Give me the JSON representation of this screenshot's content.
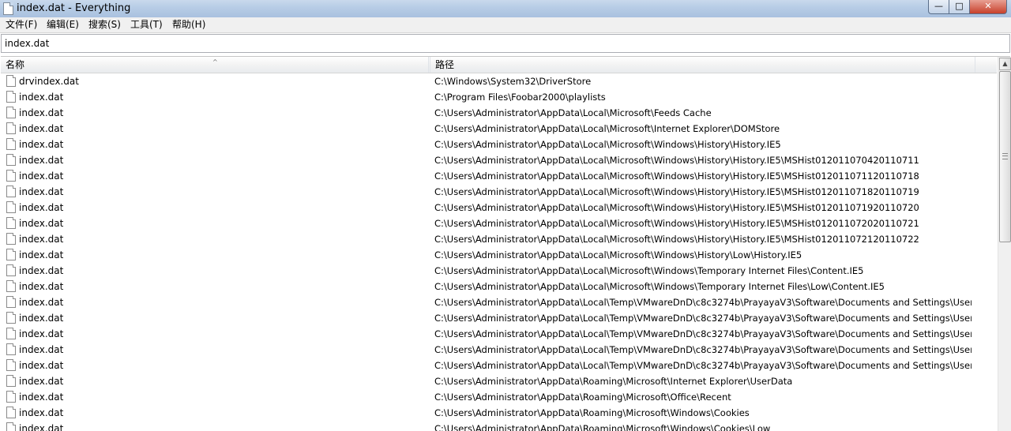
{
  "window": {
    "title": "index.dat - Everything",
    "controls": {
      "minimize": "—",
      "maximize": "□",
      "close": "✕"
    }
  },
  "menu": [
    {
      "label": "文件(F)"
    },
    {
      "label": "编辑(E)"
    },
    {
      "label": "搜索(S)"
    },
    {
      "label": "工具(T)"
    },
    {
      "label": "帮助(H)"
    }
  ],
  "search": {
    "value": "index.dat"
  },
  "columns": {
    "name": "名称",
    "path": "路径",
    "sort_indicator": "^"
  },
  "rows": [
    {
      "name": "drvindex.dat",
      "path": "C:\\Windows\\System32\\DriverStore"
    },
    {
      "name": "index.dat",
      "path": "C:\\Program Files\\Foobar2000\\playlists"
    },
    {
      "name": "index.dat",
      "path": "C:\\Users\\Administrator\\AppData\\Local\\Microsoft\\Feeds Cache"
    },
    {
      "name": "index.dat",
      "path": "C:\\Users\\Administrator\\AppData\\Local\\Microsoft\\Internet Explorer\\DOMStore"
    },
    {
      "name": "index.dat",
      "path": "C:\\Users\\Administrator\\AppData\\Local\\Microsoft\\Windows\\History\\History.IE5"
    },
    {
      "name": "index.dat",
      "path": "C:\\Users\\Administrator\\AppData\\Local\\Microsoft\\Windows\\History\\History.IE5\\MSHist012011070420110711"
    },
    {
      "name": "index.dat",
      "path": "C:\\Users\\Administrator\\AppData\\Local\\Microsoft\\Windows\\History\\History.IE5\\MSHist012011071120110718"
    },
    {
      "name": "index.dat",
      "path": "C:\\Users\\Administrator\\AppData\\Local\\Microsoft\\Windows\\History\\History.IE5\\MSHist012011071820110719"
    },
    {
      "name": "index.dat",
      "path": "C:\\Users\\Administrator\\AppData\\Local\\Microsoft\\Windows\\History\\History.IE5\\MSHist012011071920110720"
    },
    {
      "name": "index.dat",
      "path": "C:\\Users\\Administrator\\AppData\\Local\\Microsoft\\Windows\\History\\History.IE5\\MSHist012011072020110721"
    },
    {
      "name": "index.dat",
      "path": "C:\\Users\\Administrator\\AppData\\Local\\Microsoft\\Windows\\History\\History.IE5\\MSHist012011072120110722"
    },
    {
      "name": "index.dat",
      "path": "C:\\Users\\Administrator\\AppData\\Local\\Microsoft\\Windows\\History\\Low\\History.IE5"
    },
    {
      "name": "index.dat",
      "path": "C:\\Users\\Administrator\\AppData\\Local\\Microsoft\\Windows\\Temporary Internet Files\\Content.IE5"
    },
    {
      "name": "index.dat",
      "path": "C:\\Users\\Administrator\\AppData\\Local\\Microsoft\\Windows\\Temporary Internet Files\\Low\\Content.IE5"
    },
    {
      "name": "index.dat",
      "path": "C:\\Users\\Administrator\\AppData\\Local\\Temp\\VMwareDnD\\c8c3274b\\PrayayaV3\\Software\\Documents and Settings\\User\\Cook..."
    },
    {
      "name": "index.dat",
      "path": "C:\\Users\\Administrator\\AppData\\Local\\Temp\\VMwareDnD\\c8c3274b\\PrayayaV3\\Software\\Documents and Settings\\User\\Local..."
    },
    {
      "name": "index.dat",
      "path": "C:\\Users\\Administrator\\AppData\\Local\\Temp\\VMwareDnD\\c8c3274b\\PrayayaV3\\Software\\Documents and Settings\\User\\Local..."
    },
    {
      "name": "index.dat",
      "path": "C:\\Users\\Administrator\\AppData\\Local\\Temp\\VMwareDnD\\c8c3274b\\PrayayaV3\\Software\\Documents and Settings\\User\\Local..."
    },
    {
      "name": "index.dat",
      "path": "C:\\Users\\Administrator\\AppData\\Local\\Temp\\VMwareDnD\\c8c3274b\\PrayayaV3\\Software\\Documents and Settings\\User\\Local..."
    },
    {
      "name": "index.dat",
      "path": "C:\\Users\\Administrator\\AppData\\Roaming\\Microsoft\\Internet Explorer\\UserData"
    },
    {
      "name": "index.dat",
      "path": "C:\\Users\\Administrator\\AppData\\Roaming\\Microsoft\\Office\\Recent"
    },
    {
      "name": "index.dat",
      "path": "C:\\Users\\Administrator\\AppData\\Roaming\\Microsoft\\Windows\\Cookies"
    },
    {
      "name": "index.dat",
      "path": "C:\\Users\\Administrator\\AppData\\Roaming\\Microsoft\\Windows\\Cookies\\Low"
    }
  ],
  "scrollbar": {
    "up_arrow": "▲"
  }
}
